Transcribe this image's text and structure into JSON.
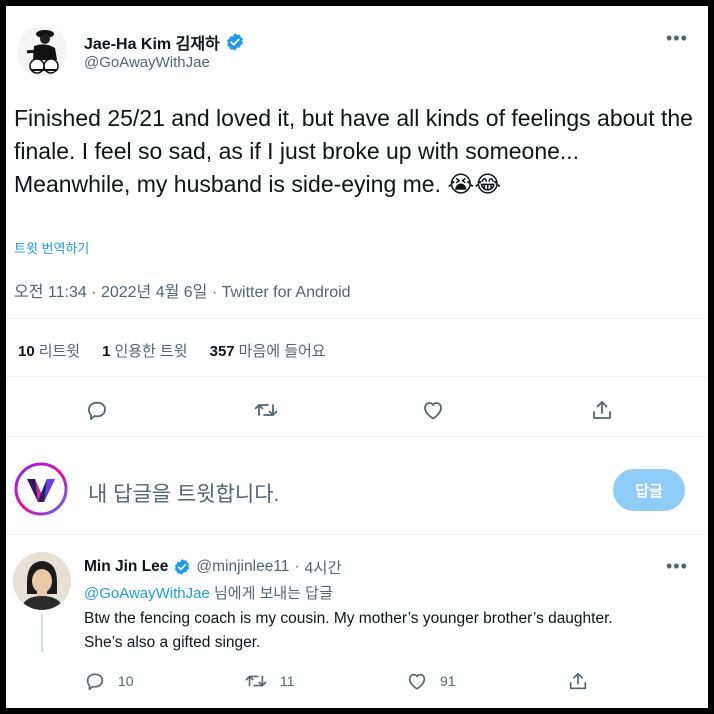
{
  "author": {
    "name": "Jae-Ha Kim 김재하",
    "handle": "@GoAwayWithJae"
  },
  "tweet": {
    "text": "Finished 25/21 and loved it, but have all kinds of feelings about the finale. I feel so sad, as if I just broke up with someone... Meanwhile, my husband is side-eying me. 😭😂",
    "translate_label": "트윗 번역하기",
    "meta": "오전 11:34 · 2022년 4월 6일 · Twitter for Android"
  },
  "stats": {
    "retweets_count": "10",
    "retweets_label": "리트윗",
    "quotes_count": "1",
    "quotes_label": "인용한 트윗",
    "likes_count": "357",
    "likes_label": "마음에 들어요"
  },
  "actions": [
    "reply",
    "retweet",
    "like",
    "share"
  ],
  "compose": {
    "placeholder": "내 답글을 트윗합니다.",
    "reply_button": "답글"
  },
  "reply": {
    "name": "Min Jin Lee",
    "handle": "@minjinlee11",
    "separator": "·",
    "time": "4시간",
    "mention": "@GoAwayWithJae",
    "mention_suffix": " 님에게 보내는 답글",
    "text": "Btw the fencing coach is my cousin. My mother’s younger brother’s daughter. She’s also a gifted singer.",
    "reply_count": "10",
    "retweet_count": "11",
    "like_count": "91"
  },
  "colors": {
    "accent": "#1d9bf0",
    "reply_button_disabled": "#8ecdf8",
    "secondary_text": "#536471",
    "primary_text": "#0f1419"
  }
}
